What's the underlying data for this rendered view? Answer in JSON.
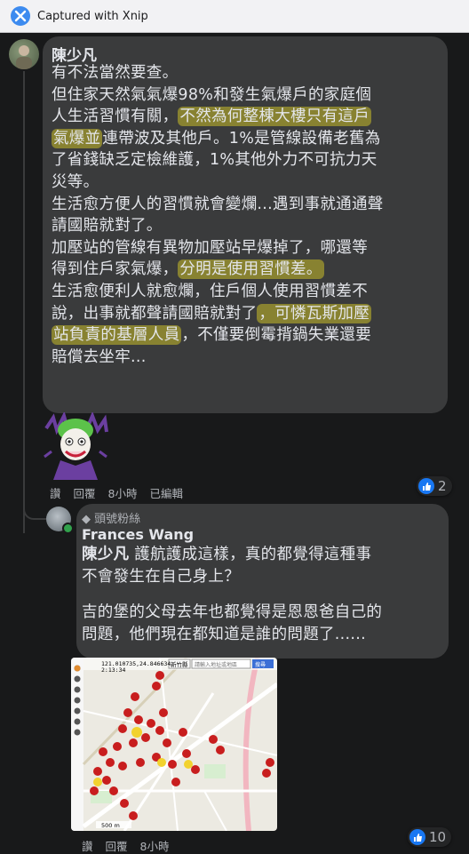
{
  "window": {
    "title": "Captured with Xnip",
    "logo_icon": "xnip-logo-icon"
  },
  "comment": {
    "author": "陳少凡",
    "lines": [
      {
        "text": "有不法當然要查。"
      },
      {
        "text": "但住家天然氣氣爆98%和發生氣爆戶的家庭個"
      },
      {
        "pre": "人生活習慣有關，",
        "hl": "不然為何整棟大樓只有這戶"
      },
      {
        "hl": "氣爆並",
        "post": "連帶波及其他戶。1%是管線設備老舊為"
      },
      {
        "text": "了省錢缺乏定檢維護，1%其他外力不可抗力天"
      },
      {
        "text": "災等。"
      },
      {
        "text": "生活愈方便人的習慣就會變爛...遇到事就通通聲"
      },
      {
        "text": "請國賠就對了。"
      },
      {
        "text": "加壓站的管線有異物加壓站早爆掉了，哪還等"
      },
      {
        "pre": "得到住戶家氣爆，",
        "hl": "分明是使用習慣差。"
      },
      {
        "text": "生活愈便利人就愈爛，住戶個人使用習慣差不"
      },
      {
        "pre": "說，出事就都聲請國賠就對了",
        "hl": "，可憐瓦斯加壓"
      },
      {
        "hl": "站負責的基層人員",
        "post": "，不僅要倒霉揹鍋失業還要"
      },
      {
        "text": "賠償去坐牢..."
      }
    ],
    "actions": {
      "like": "讚",
      "reply": "回覆",
      "time": "8小時",
      "edited": "已編輯"
    },
    "reaction_count": "2"
  },
  "reply": {
    "badge": "頭號粉絲",
    "badge_icon": "diamond-icon",
    "author": "Frances Wang",
    "mention": "陳少凡",
    "line1_rest": " 護航護成這樣，真的都覺得這種事",
    "line2": "不會發生在自己身上？",
    "line3": "吉的堡的父母去年也都覺得是恩恩爸自己的",
    "line4": "問題，他們現在都知道是誰的問題了......",
    "actions": {
      "like": "讚",
      "reply": "回覆",
      "time": "8小時"
    },
    "reaction_count": "10"
  },
  "map": {
    "coords": "121.010735,24.846634",
    "time": "2:13:34",
    "district": "新竹縣",
    "search_placeholder": "請輸入地址或地區",
    "search_button": "搜尋",
    "scale": "500 m"
  },
  "colors": {
    "background": "#18191a",
    "bubble": "#3a3b3c",
    "highlight": "#c8be28",
    "like_blue": "#1877f2"
  }
}
